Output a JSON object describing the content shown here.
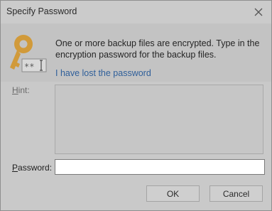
{
  "window": {
    "title": "Specify Password",
    "close_icon": "close-icon"
  },
  "header": {
    "icon": "key-password-icon",
    "message": "One or more backup files are encrypted. Type in the encryption password for the backup files.",
    "lost_link": "I have lost the password"
  },
  "hint": {
    "label_mnemonic": "H",
    "label_rest": "int:",
    "value": ""
  },
  "password": {
    "label_mnemonic": "P",
    "label_rest": "assword:",
    "value": ""
  },
  "buttons": {
    "ok": "OK",
    "cancel": "Cancel"
  },
  "colors": {
    "link": "#2f5f9a",
    "key_gold": "#d19a3a",
    "overlay_gray": "#c9c9c9"
  }
}
